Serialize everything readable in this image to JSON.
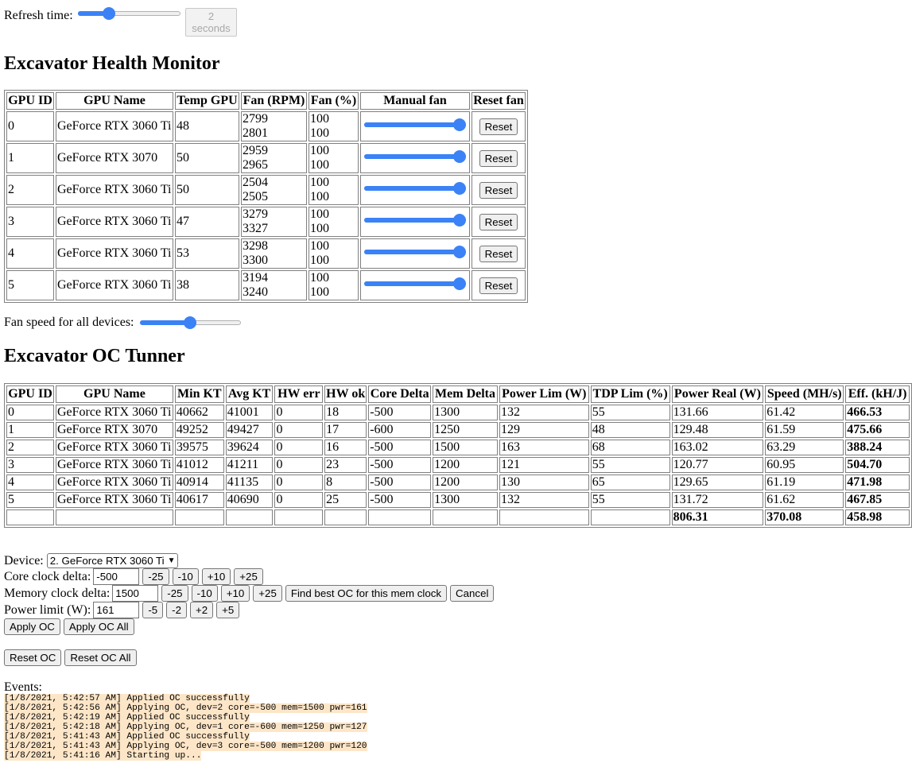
{
  "refresh": {
    "label": "Refresh time:",
    "value_number": "2",
    "value_unit": "seconds",
    "slider_fraction": 0.27
  },
  "health": {
    "title": "Excavator Health Monitor",
    "headers": [
      "GPU ID",
      "GPU Name",
      "Temp GPU",
      "Fan (RPM)",
      "Fan (%)",
      "Manual fan",
      "Reset fan"
    ],
    "rows": [
      {
        "id": "0",
        "name": "GeForce RTX 3060 Ti",
        "temp": "48",
        "rpm1": "2799",
        "rpm2": "2801",
        "pct1": "100",
        "pct2": "100",
        "manual": 1.0,
        "reset": "Reset"
      },
      {
        "id": "1",
        "name": "GeForce RTX 3070",
        "temp": "50",
        "rpm1": "2959",
        "rpm2": "2965",
        "pct1": "100",
        "pct2": "100",
        "manual": 1.0,
        "reset": "Reset"
      },
      {
        "id": "2",
        "name": "GeForce RTX 3060 Ti",
        "temp": "50",
        "rpm1": "2504",
        "rpm2": "2505",
        "pct1": "100",
        "pct2": "100",
        "manual": 1.0,
        "reset": "Reset"
      },
      {
        "id": "3",
        "name": "GeForce RTX 3060 Ti",
        "temp": "47",
        "rpm1": "3279",
        "rpm2": "3327",
        "pct1": "100",
        "pct2": "100",
        "manual": 1.0,
        "reset": "Reset"
      },
      {
        "id": "4",
        "name": "GeForce RTX 3060 Ti",
        "temp": "53",
        "rpm1": "3298",
        "rpm2": "3300",
        "pct1": "100",
        "pct2": "100",
        "manual": 1.0,
        "reset": "Reset"
      },
      {
        "id": "5",
        "name": "GeForce RTX 3060 Ti",
        "temp": "38",
        "rpm1": "3194",
        "rpm2": "3240",
        "pct1": "100",
        "pct2": "100",
        "manual": 1.0,
        "reset": "Reset"
      }
    ],
    "fan_all_label": "Fan speed for all devices:",
    "fan_all_fraction": 0.5
  },
  "oc": {
    "title": "Excavator OC Tunner",
    "headers": [
      "GPU ID",
      "GPU Name",
      "Min KT",
      "Avg KT",
      "HW err",
      "HW ok",
      "Core Delta",
      "Mem Delta",
      "Power Lim (W)",
      "TDP Lim (%)",
      "Power Real (W)",
      "Speed (MH/s)",
      "Eff. (kH/J)"
    ],
    "rows": [
      [
        "0",
        "GeForce RTX 3060 Ti",
        "40662",
        "41001",
        "0",
        "18",
        "-500",
        "1300",
        "132",
        "55",
        "131.66",
        "61.42",
        "466.53"
      ],
      [
        "1",
        "GeForce RTX 3070",
        "49252",
        "49427",
        "0",
        "17",
        "-600",
        "1250",
        "129",
        "48",
        "129.48",
        "61.59",
        "475.66"
      ],
      [
        "2",
        "GeForce RTX 3060 Ti",
        "39575",
        "39624",
        "0",
        "16",
        "-500",
        "1500",
        "163",
        "68",
        "163.02",
        "63.29",
        "388.24"
      ],
      [
        "3",
        "GeForce RTX 3060 Ti",
        "41012",
        "41211",
        "0",
        "23",
        "-500",
        "1200",
        "121",
        "55",
        "120.77",
        "60.95",
        "504.70"
      ],
      [
        "4",
        "GeForce RTX 3060 Ti",
        "40914",
        "41135",
        "0",
        "8",
        "-500",
        "1200",
        "130",
        "65",
        "129.65",
        "61.19",
        "471.98"
      ],
      [
        "5",
        "GeForce RTX 3060 Ti",
        "40617",
        "40690",
        "0",
        "25",
        "-500",
        "1300",
        "132",
        "55",
        "131.72",
        "61.62",
        "467.85"
      ]
    ],
    "totals": {
      "power": "806.31",
      "speed": "370.08",
      "eff": "458.98"
    }
  },
  "controls": {
    "device_label": "Device:",
    "device_value": "2. GeForce RTX 3060 Ti",
    "core_label": "Core clock delta:",
    "core_value": "-500",
    "core_buttons": [
      "-25",
      "-10",
      "+10",
      "+25"
    ],
    "mem_label": "Memory clock delta:",
    "mem_value": "1500",
    "mem_buttons": [
      "-25",
      "-10",
      "+10",
      "+25"
    ],
    "find_best": "Find best OC for this mem clock",
    "cancel": "Cancel",
    "power_label": "Power limit (W):",
    "power_value": "161",
    "power_buttons": [
      "-5",
      "-2",
      "+2",
      "+5"
    ],
    "apply_oc": "Apply OC",
    "apply_oc_all": "Apply OC All",
    "reset_oc": "Reset OC",
    "reset_oc_all": "Reset OC All"
  },
  "events": {
    "label": "Events:",
    "lines": [
      "[1/8/2021, 5:42:57 AM] Applied OC successfully",
      "[1/8/2021, 5:42:56 AM] Applying OC, dev=2 core=-500 mem=1500 pwr=161",
      "[1/8/2021, 5:42:19 AM] Applied OC successfully",
      "[1/8/2021, 5:42:18 AM] Applying OC, dev=1 core=-600 mem=1250 pwr=127",
      "[1/8/2021, 5:41:43 AM] Applied OC successfully",
      "[1/8/2021, 5:41:43 AM] Applying OC, dev=3 core=-500 mem=1200 pwr=120",
      "[1/8/2021, 5:41:16 AM] Starting up..."
    ]
  },
  "colors": {
    "accent": "#3b82f6",
    "event_bg": "#fde6c8"
  }
}
